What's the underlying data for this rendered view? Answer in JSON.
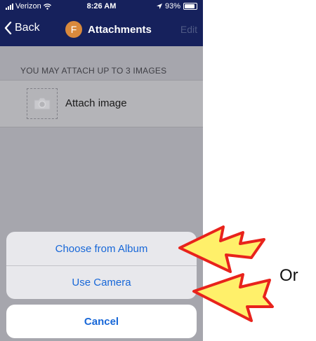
{
  "status_bar": {
    "carrier": "Verizon",
    "time": "8:26 AM",
    "battery": "93%"
  },
  "nav": {
    "back_label": "Back",
    "avatar_letter": "F",
    "title": "Attachments",
    "edit_label": "Edit"
  },
  "section": {
    "header": "YOU MAY ATTACH UP TO 3 IMAGES"
  },
  "attach": {
    "label": "Attach image",
    "icon": "camera-icon"
  },
  "action_sheet": {
    "options": [
      {
        "label": "Choose from Album"
      },
      {
        "label": "Use Camera"
      }
    ],
    "cancel_label": "Cancel"
  },
  "annotation": {
    "or_text": "Or",
    "arrow_fill": "#fff06a",
    "arrow_stroke": "#e8231c"
  },
  "colors": {
    "nav_background": "#16215c",
    "accent_blue": "#1767d8",
    "avatar": "#d9893c"
  }
}
